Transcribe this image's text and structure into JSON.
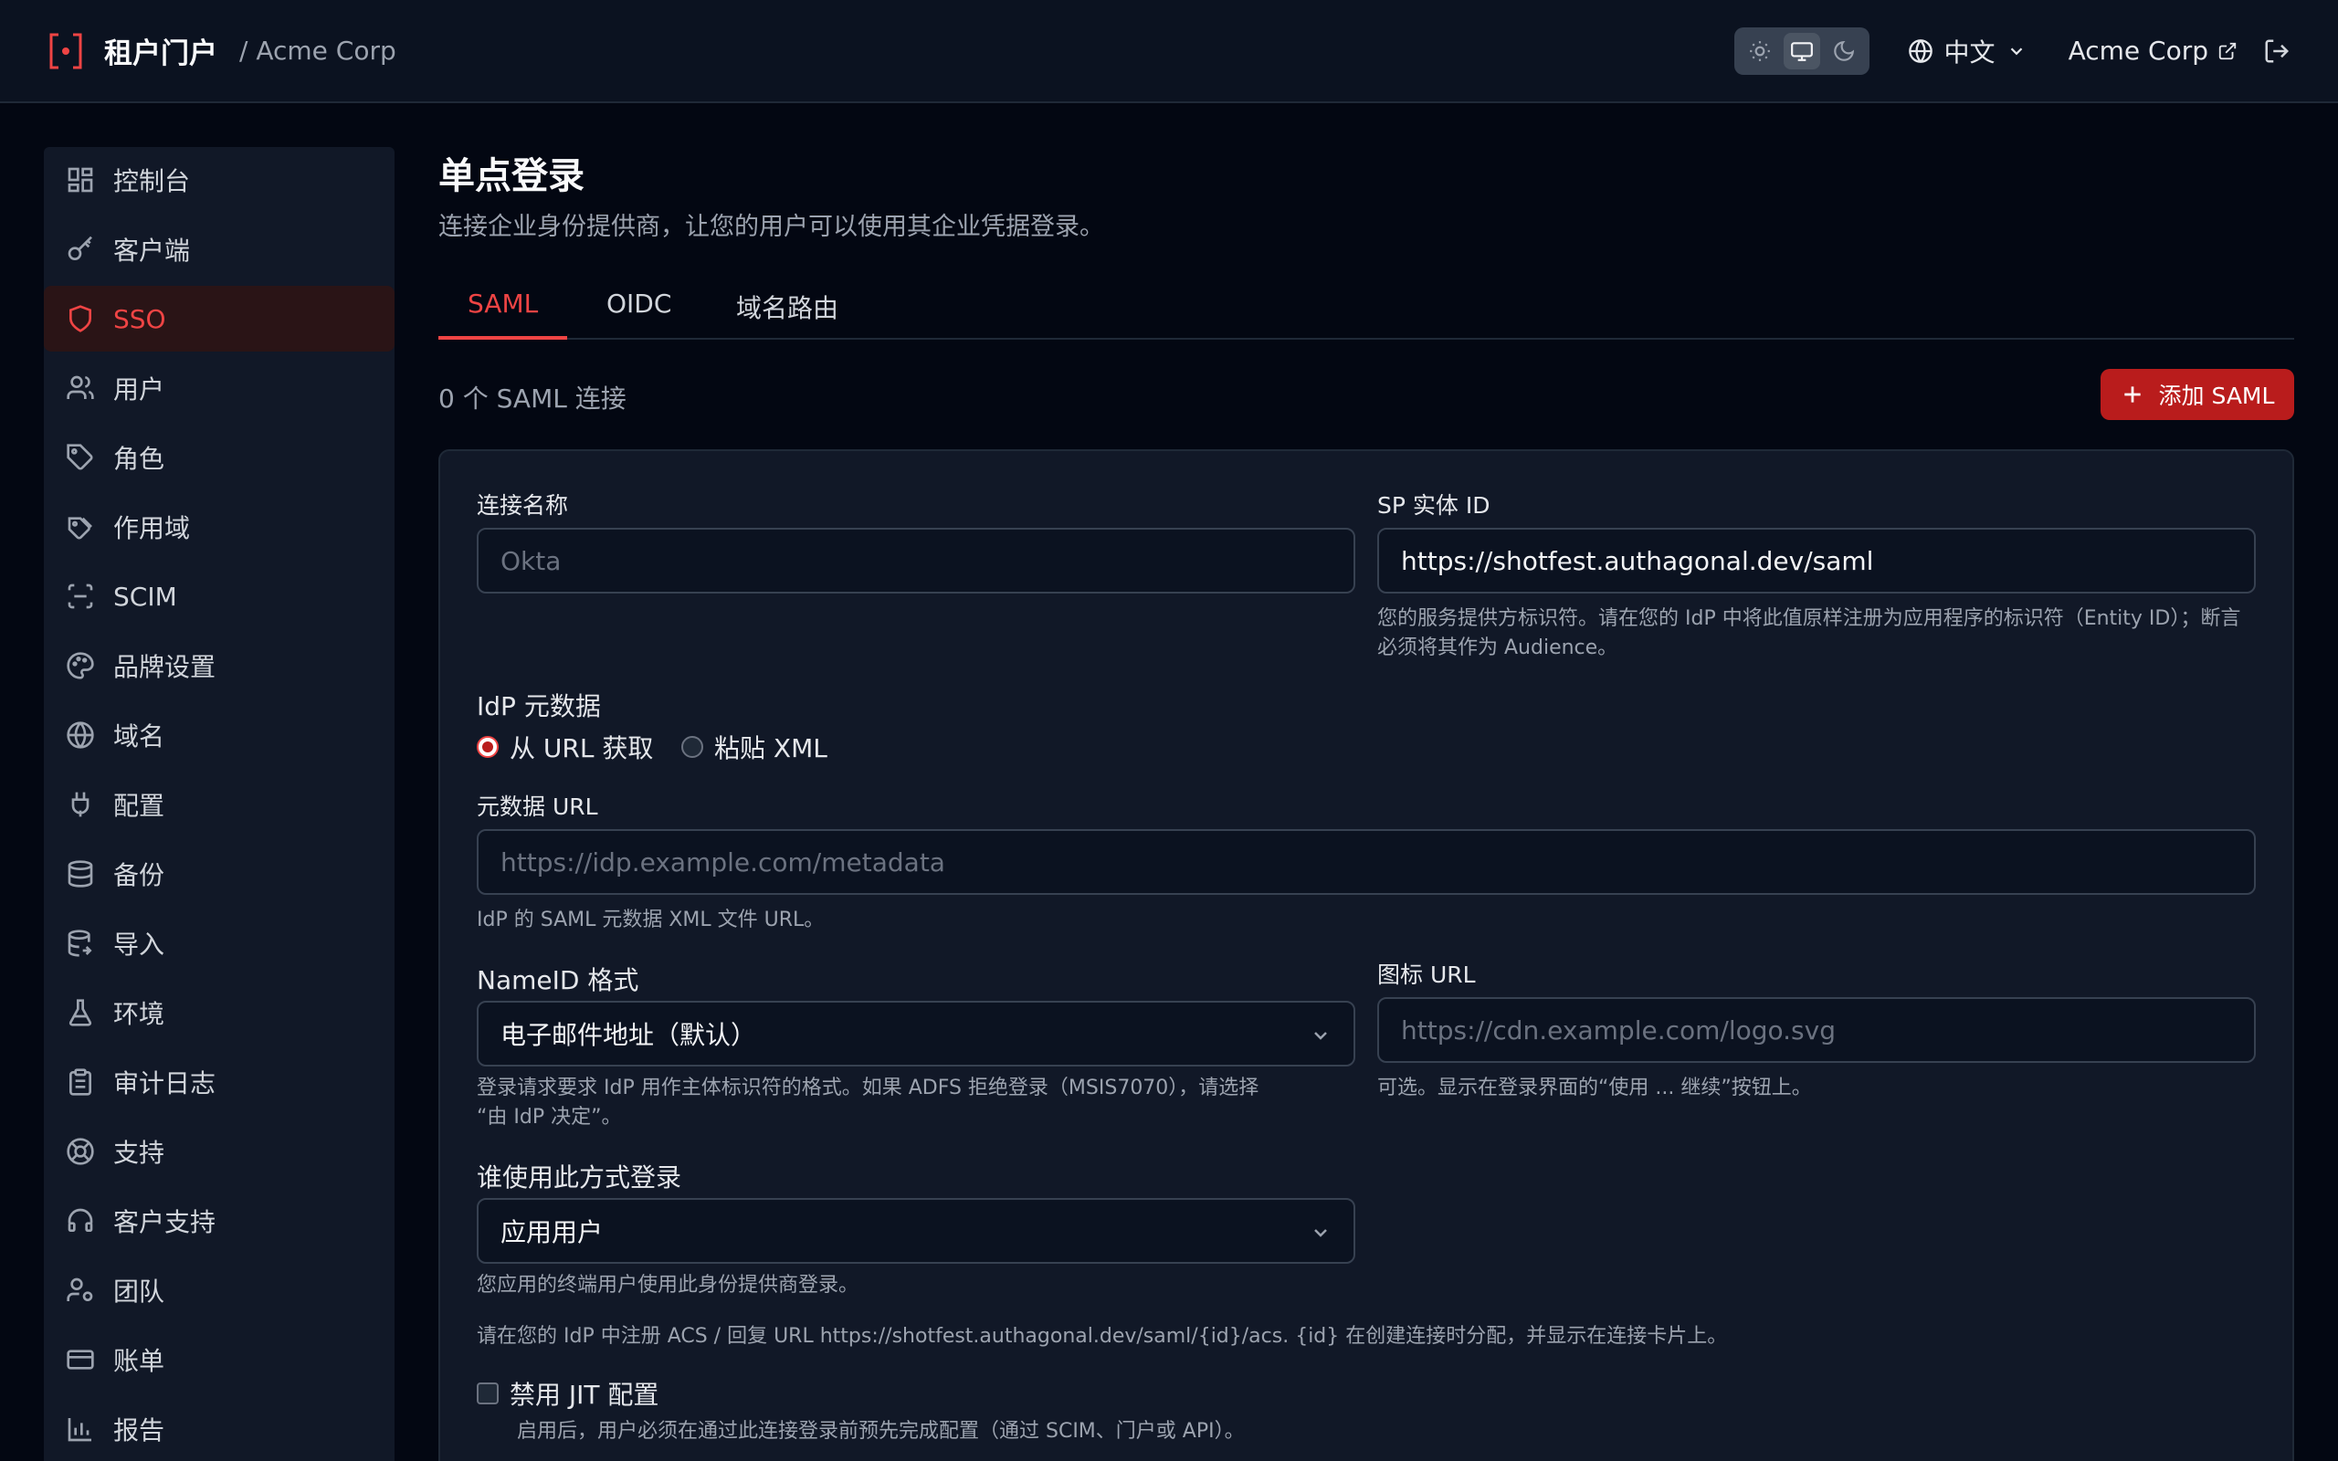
{
  "header": {
    "brand": "租户门户",
    "tenant": "/ Acme Corp",
    "language": "中文",
    "account": "Acme Corp",
    "theme_options": [
      "sun-icon",
      "monitor-icon",
      "moon-icon"
    ],
    "active_theme": "monitor-icon"
  },
  "sidebar": {
    "items": [
      {
        "label": "控制台",
        "icon": "dashboard-icon"
      },
      {
        "label": "客户端",
        "icon": "key-icon"
      },
      {
        "label": "SSO",
        "icon": "shield-icon"
      },
      {
        "label": "用户",
        "icon": "users-icon"
      },
      {
        "label": "角色",
        "icon": "tag-icon"
      },
      {
        "label": "作用域",
        "icon": "tags-icon"
      },
      {
        "label": "SCIM",
        "icon": "scan-icon"
      },
      {
        "label": "品牌设置",
        "icon": "palette-icon"
      },
      {
        "label": "域名",
        "icon": "globe-icon"
      },
      {
        "label": "配置",
        "icon": "plug-icon"
      },
      {
        "label": "备份",
        "icon": "database-icon"
      },
      {
        "label": "导入",
        "icon": "database-import-icon"
      },
      {
        "label": "环境",
        "icon": "flask-icon"
      },
      {
        "label": "审计日志",
        "icon": "clipboard-icon"
      },
      {
        "label": "支持",
        "icon": "lifebuoy-icon"
      },
      {
        "label": "客户支持",
        "icon": "headset-icon"
      },
      {
        "label": "团队",
        "icon": "user-cog-icon"
      },
      {
        "label": "账单",
        "icon": "credit-card-icon"
      },
      {
        "label": "报告",
        "icon": "bar-chart-icon"
      }
    ],
    "active_index": 2
  },
  "page": {
    "title": "单点登录",
    "subtitle": "连接企业身份提供商，让您的用户可以使用其企业凭据登录。",
    "tabs": [
      "SAML",
      "OIDC",
      "域名路由"
    ],
    "active_tab": 0,
    "count": "0 个 SAML 连接",
    "add_button": "添加 SAML"
  },
  "form": {
    "connection_name": {
      "label": "连接名称",
      "placeholder": "Okta"
    },
    "sp_entity_id": {
      "label": "SP 实体 ID",
      "value": "https://shotfest.authagonal.dev/saml",
      "help_line1": "您的服务提供方标识符。请在您的 IdP 中将此值原样注册为应用程序的标识符（Entity ID）；断言",
      "help_line2": "必须将其作为 Audience。"
    },
    "idp_metadata": {
      "label": "IdP 元数据",
      "option_url": "从 URL 获取",
      "option_xml": "粘贴 XML",
      "selected": "url"
    },
    "metadata_url": {
      "label": "元数据 URL",
      "placeholder": "https://idp.example.com/metadata",
      "help": "IdP 的 SAML 元数据 XML 文件 URL。"
    },
    "nameid_format": {
      "label": "NameID 格式",
      "value": "电子邮件地址（默认）",
      "help_line1": "登录请求要求 IdP 用作主体标识符的格式。如果 ADFS 拒绝登录（MSIS7070），请选择",
      "help_line2": "“由 IdP 决定”。"
    },
    "icon_url": {
      "label": "图标 URL",
      "placeholder": "https://cdn.example.com/logo.svg",
      "help": "可选。显示在登录界面的“使用 ... 继续”按钮上。"
    },
    "who_signs_in": {
      "label": "谁使用此方式登录",
      "value": "应用用户",
      "help": "您应用的终端用户使用此身份提供商登录。"
    },
    "acs_note": "请在您的 IdP 中注册 ACS / 回复 URL https://shotfest.authagonal.dev/saml/{id}/acs. {id} 在创建连接时分配，并显示在连接卡片上。",
    "jit": {
      "label": "禁用 JIT 配置",
      "help": "启用后，用户必须在通过此连接登录前预先完成配置（通过 SCIM、门户或 API）。",
      "checked": false
    }
  }
}
